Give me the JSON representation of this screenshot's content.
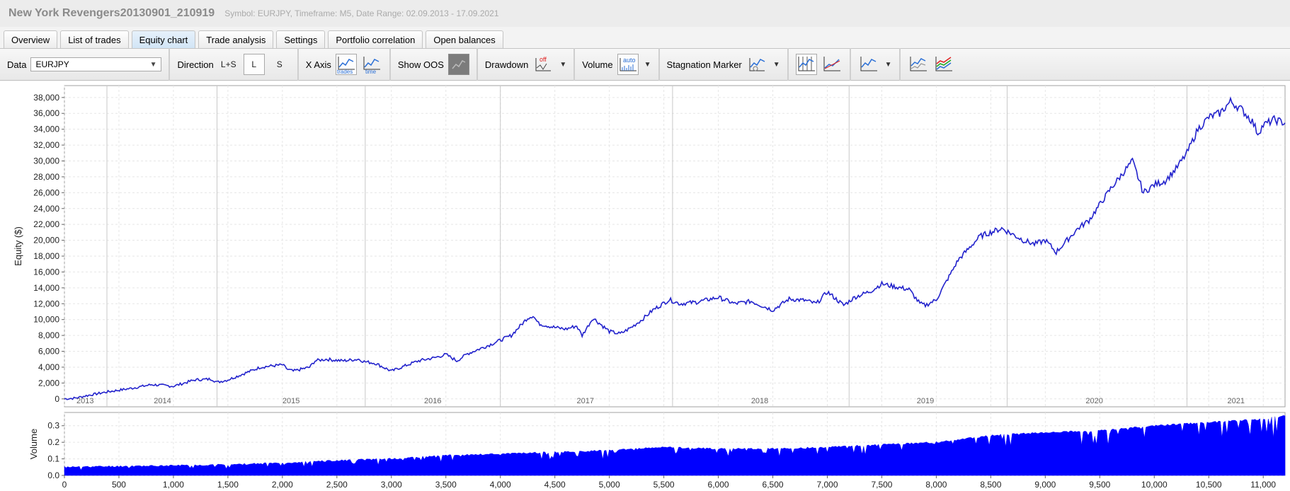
{
  "header": {
    "title": "New York Revengers20130901_210919",
    "subtitle": "Symbol: EURJPY, Timeframe: M5, Date Range: 02.09.2013 - 17.09.2021"
  },
  "tabs": [
    {
      "label": "Overview"
    },
    {
      "label": "List of trades"
    },
    {
      "label": "Equity chart",
      "active": true
    },
    {
      "label": "Trade analysis"
    },
    {
      "label": "Settings"
    },
    {
      "label": "Portfolio correlation"
    },
    {
      "label": "Open balances"
    }
  ],
  "toolbar": {
    "data_label": "Data",
    "data_value": "EURJPY",
    "direction_label": "Direction",
    "direction_both": "L+S",
    "direction_long": "L",
    "direction_short": "S",
    "xaxis_label": "X Axis",
    "xaxis_trades": "trades",
    "xaxis_time": "time",
    "show_oos_label": "Show OOS",
    "drawdown_label": "Drawdown",
    "drawdown_state": "off",
    "volume_label": "Volume",
    "volume_state": "auto",
    "stagnation_label": "Stagnation Marker"
  },
  "chart_data": [
    {
      "type": "line",
      "ylabel": "Equity ($)",
      "ylim": [
        -1000,
        39500
      ],
      "yticks": [
        "0",
        "2,000",
        "4,000",
        "6,000",
        "8,000",
        "10,000",
        "12,000",
        "14,000",
        "16,000",
        "18,000",
        "20,000",
        "22,000",
        "24,000",
        "26,000",
        "28,000",
        "30,000",
        "32,000",
        "34,000",
        "36,000",
        "38,000"
      ],
      "ytick_values": [
        0,
        2000,
        4000,
        6000,
        8000,
        10000,
        12000,
        14000,
        16000,
        18000,
        20000,
        22000,
        24000,
        26000,
        28000,
        30000,
        32000,
        34000,
        36000,
        38000
      ],
      "xlim": [
        0,
        11200
      ],
      "year_labels": [
        "2013",
        "2014",
        "2015",
        "2016",
        "2017",
        "2018",
        "2019",
        "2020",
        "2021"
      ],
      "year_label_trades": [
        190,
        900,
        2080,
        3380,
        4780,
        6380,
        7900,
        9450,
        10750
      ],
      "year_boundaries": [
        390,
        1400,
        2760,
        4000,
        5580,
        7200,
        8650,
        10300
      ],
      "series": [
        {
          "color": "#2222cc",
          "x": [
            0,
            100,
            200,
            400,
            600,
            800,
            1000,
            1100,
            1200,
            1350,
            1400,
            1500,
            1650,
            1800,
            2000,
            2050,
            2100,
            2250,
            2300,
            2400,
            2550,
            2700,
            2750,
            2850,
            3000,
            3150,
            3250,
            3400,
            3500,
            3600,
            3700,
            3900,
            4100,
            4250,
            4300,
            4350,
            4500,
            4600,
            4700,
            4750,
            4850,
            5000,
            5100,
            5200,
            5300,
            5400,
            5550,
            5650,
            5800,
            6000,
            6150,
            6300,
            6500,
            6650,
            6800,
            6900,
            7000,
            7150,
            7250,
            7400,
            7500,
            7600,
            7750,
            7850,
            7900,
            8000,
            8200,
            8400,
            8600,
            8800,
            8900,
            9000,
            9100,
            9200,
            9300,
            9400,
            9600,
            9800,
            9900,
            10000,
            10100,
            10200,
            10300,
            10400,
            10500,
            10600,
            10700,
            10800,
            10900,
            10950,
            11000,
            11100,
            11200
          ],
          "y": [
            0,
            100,
            400,
            900,
            1300,
            1800,
            1600,
            2000,
            2400,
            2500,
            2100,
            2400,
            3200,
            4000,
            4300,
            3700,
            3500,
            4000,
            4800,
            5000,
            4800,
            5000,
            4700,
            4500,
            3500,
            4300,
            4800,
            5200,
            5600,
            4800,
            5700,
            6800,
            8000,
            10200,
            10500,
            9500,
            9000,
            8800,
            9200,
            8000,
            10200,
            8500,
            8200,
            9000,
            10000,
            11200,
            12500,
            12000,
            12200,
            12800,
            12000,
            12300,
            11200,
            12600,
            12400,
            12000,
            13500,
            11800,
            12800,
            13600,
            14500,
            14200,
            13800,
            12000,
            11800,
            12500,
            17500,
            20500,
            21500,
            20000,
            19500,
            20000,
            18500,
            20000,
            21500,
            22500,
            26500,
            30000,
            26000,
            27000,
            27500,
            29000,
            31000,
            34000,
            35500,
            36000,
            37500,
            36500,
            35000,
            33500,
            34500,
            35200,
            34800
          ]
        }
      ]
    },
    {
      "type": "area",
      "ylabel": "Volume",
      "ylim": [
        0,
        0.38
      ],
      "yticks": [
        "0.0",
        "0.1",
        "0.2",
        "0.3"
      ],
      "ytick_values": [
        0,
        0.1,
        0.2,
        0.3
      ],
      "xlim": [
        0,
        11200
      ],
      "xticks": [
        "0",
        "500",
        "1,000",
        "1,500",
        "2,000",
        "2,500",
        "3,000",
        "3,500",
        "4,000",
        "4,500",
        "5,000",
        "5,500",
        "6,000",
        "6,500",
        "7,000",
        "7,500",
        "8,000",
        "8,500",
        "9,000",
        "9,500",
        "10,000",
        "10,500",
        "11,000"
      ],
      "xtick_values": [
        0,
        500,
        1000,
        1500,
        2000,
        2500,
        3000,
        3500,
        4000,
        4500,
        5000,
        5500,
        6000,
        6500,
        7000,
        7500,
        8000,
        8500,
        9000,
        9500,
        10000,
        10500,
        11000
      ],
      "series": [
        {
          "color": "#0000ff",
          "x": [
            0,
            500,
            1000,
            1500,
            2000,
            2500,
            3000,
            3500,
            4000,
            4500,
            5000,
            5500,
            6000,
            6500,
            7000,
            7500,
            8000,
            8500,
            9000,
            9500,
            10000,
            10500,
            11000,
            11200
          ],
          "y": [
            0.05,
            0.055,
            0.06,
            0.065,
            0.075,
            0.09,
            0.1,
            0.12,
            0.13,
            0.14,
            0.15,
            0.17,
            0.16,
            0.16,
            0.17,
            0.185,
            0.2,
            0.24,
            0.26,
            0.27,
            0.3,
            0.32,
            0.34,
            0.36
          ]
        }
      ]
    }
  ]
}
